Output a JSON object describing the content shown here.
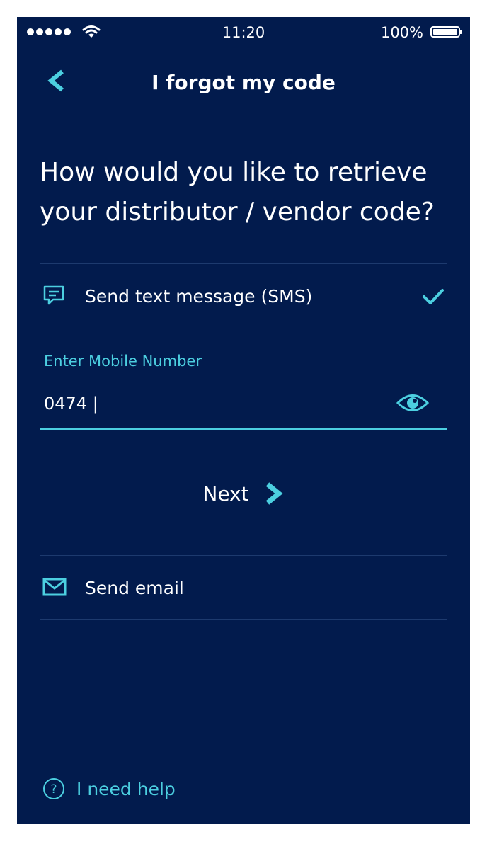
{
  "status_bar": {
    "time": "11:20",
    "battery": "100%",
    "signal_icon": "signal-dots-icon",
    "wifi_icon": "wifi-icon",
    "battery_icon": "battery-full-icon"
  },
  "header": {
    "title": "I forgot my code",
    "back_icon": "chevron-left-icon"
  },
  "question": "How would you like to retrieve your distributor / vendor code?",
  "options": [
    {
      "label": "Send text message (SMS)",
      "icon": "chat-bubble-icon",
      "selected": true
    },
    {
      "label": "Send email",
      "icon": "envelope-icon",
      "selected": false
    }
  ],
  "mobile_field": {
    "label": "Enter Mobile Number",
    "value": "0474 |",
    "visibility_icon": "eye-icon"
  },
  "next_button": {
    "label": "Next",
    "icon": "chevron-right-icon"
  },
  "help_link": {
    "label": "I need help",
    "icon": "help-circle-icon"
  },
  "colors": {
    "background": "#021b4d",
    "accent": "#4ccfe0",
    "divider": "#1d3a6e",
    "text": "#ffffff"
  }
}
